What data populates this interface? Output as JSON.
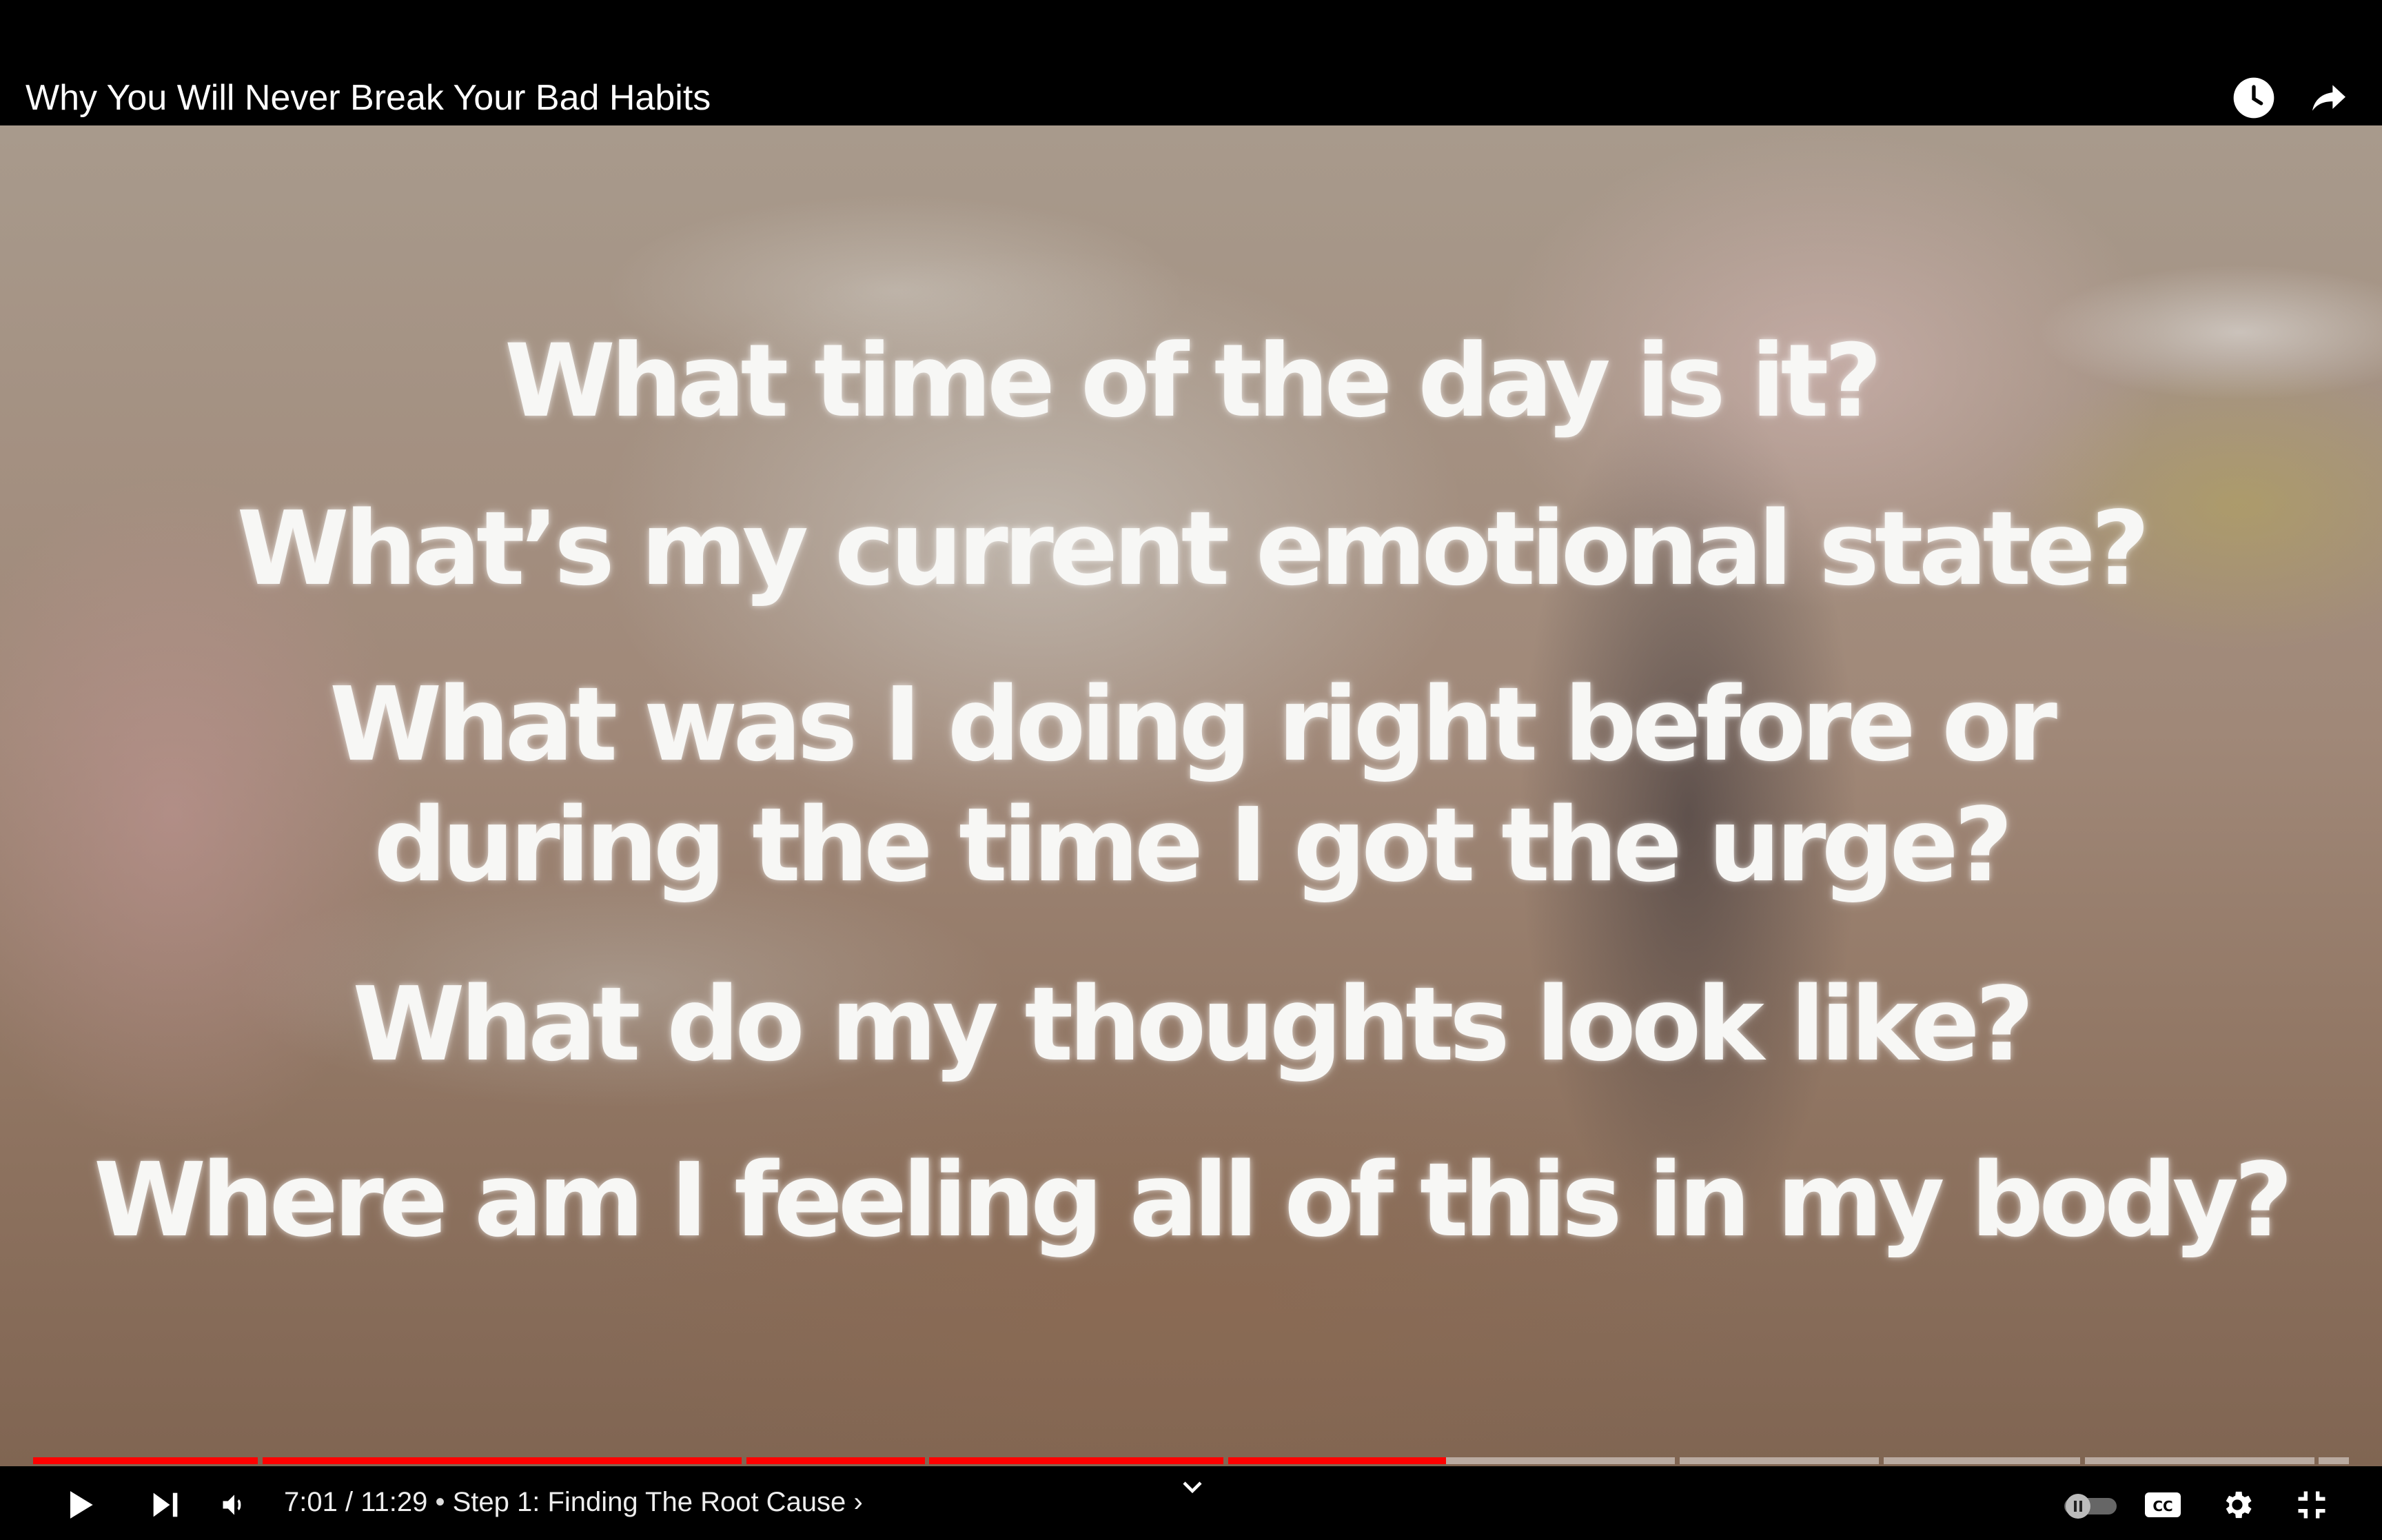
{
  "title_bar": {
    "video_title": "Why You Will Never Break Your Bad Habits"
  },
  "overlay": {
    "lines": [
      "What time of the day is it?",
      "What’s my current emotional state?",
      "What was I doing right before or",
      "during the time I got the urge?",
      "What do my thoughts look like?",
      "Where am I feeling all of this in my body?"
    ]
  },
  "controls": {
    "current_time": "7:01",
    "separator": " / ",
    "duration": "11:29",
    "chapter_bullet": " • ",
    "chapter_title": "Step 1: Finding The Root Cause",
    "chapter_arrow": "›",
    "autoplay_on": false
  },
  "progress": {
    "played_fraction": 0.61,
    "chapters": [
      {
        "start": 0.0,
        "end": 0.097
      },
      {
        "start": 0.099,
        "end": 0.306
      },
      {
        "start": 0.308,
        "end": 0.385
      },
      {
        "start": 0.387,
        "end": 0.514
      },
      {
        "start": 0.516,
        "end": 0.709
      },
      {
        "start": 0.711,
        "end": 0.797
      },
      {
        "start": 0.799,
        "end": 0.884
      },
      {
        "start": 0.886,
        "end": 0.985
      },
      {
        "start": 0.987,
        "end": 1.0
      }
    ]
  },
  "colors": {
    "accent": "#ff0000",
    "text": "#ffffff",
    "bar_background": "#000000"
  },
  "icons": {
    "watch_later": "clock-icon",
    "share": "share-arrow-icon",
    "play": "play-icon",
    "next": "skip-next-icon",
    "volume": "volume-icon",
    "autoplay": "autoplay-toggle-icon",
    "captions": "cc-icon",
    "settings": "gear-icon",
    "exit_fullscreen": "exit-fullscreen-icon",
    "chapter_chevron": "chevron-down-icon"
  }
}
